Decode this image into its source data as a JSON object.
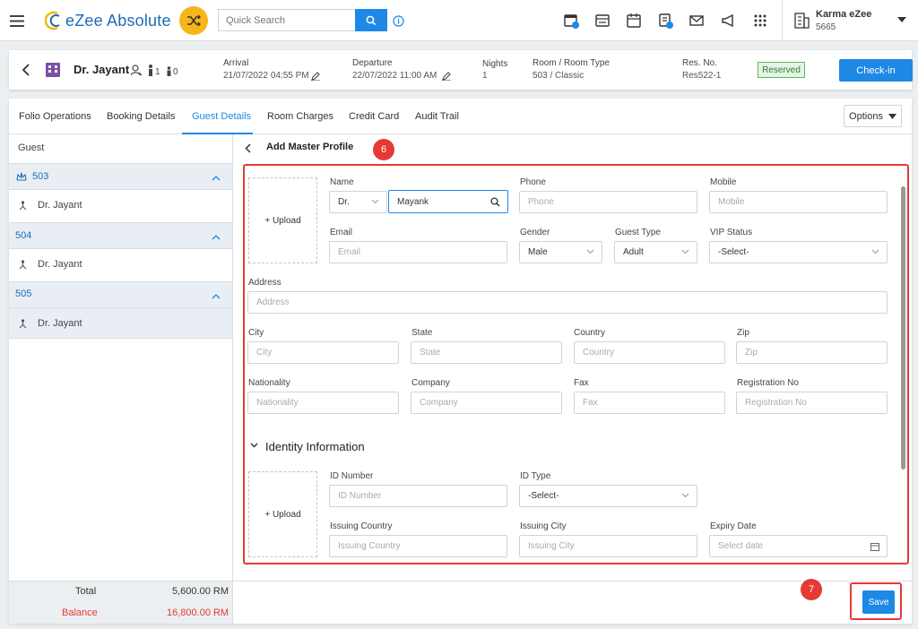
{
  "brand": {
    "name": "eZee Absolute"
  },
  "search": {
    "placeholder": "Quick Search"
  },
  "user": {
    "name": "Karma eZee",
    "id": "5665"
  },
  "reservation": {
    "guest_name": "Dr. Jayant",
    "adults": "1",
    "children": "0",
    "arrival_label": "Arrival",
    "arrival_value": "21/07/2022 04:55 PM",
    "departure_label": "Departure",
    "departure_value": "22/07/2022 11:00 AM",
    "nights_label": "Nights",
    "nights_value": "1",
    "room_label": "Room / Room Type",
    "room_value": "503 / Classic",
    "resno_label": "Res. No.",
    "resno_value": "Res522-1",
    "status": "Reserved",
    "checkin_label": "Check-in"
  },
  "tabs": [
    "Folio Operations",
    "Booking Details",
    "Guest Details",
    "Room Charges",
    "Credit Card",
    "Audit Trail"
  ],
  "options_label": "Options",
  "guest_panel": {
    "header": "Guest",
    "groups": [
      {
        "room": "503",
        "guest": "Dr. Jayant"
      },
      {
        "room": "504",
        "guest": "Dr. Jayant"
      },
      {
        "room": "505",
        "guest": "Dr. Jayant"
      }
    ],
    "total_label": "Total",
    "total_value": "5,600.00 RM",
    "balance_label": "Balance",
    "balance_value": "16,800.00 RM"
  },
  "form": {
    "title": "Add Master Profile",
    "step_badge": "6",
    "upload_label": "+ Upload",
    "name_label": "Name",
    "salutation": "Dr.",
    "name_value": "Mayank",
    "phone_label": "Phone",
    "phone_placeholder": "Phone",
    "mobile_label": "Mobile",
    "mobile_placeholder": "Mobile",
    "email_label": "Email",
    "email_placeholder": "Email",
    "gender_label": "Gender",
    "gender_value": "Male",
    "guest_type_label": "Guest Type",
    "guest_type_value": "Adult",
    "vip_label": "VIP Status",
    "vip_value": "-Select-",
    "address_label": "Address",
    "address_placeholder": "Address",
    "city_label": "City",
    "city_placeholder": "City",
    "state_label": "State",
    "state_placeholder": "State",
    "country_label": "Country",
    "country_placeholder": "Country",
    "zip_label": "Zip",
    "zip_placeholder": "Zip",
    "nationality_label": "Nationality",
    "nationality_placeholder": "Nationality",
    "company_label": "Company",
    "company_placeholder": "Company",
    "fax_label": "Fax",
    "fax_placeholder": "Fax",
    "regno_label": "Registration No",
    "regno_placeholder": "Registration No",
    "identity_title": "Identity Information",
    "idnum_label": "ID Number",
    "idnum_placeholder": "ID Number",
    "idtype_label": "ID Type",
    "idtype_value": "-Select-",
    "issuing_country_label": "Issuing Country",
    "issuing_country_placeholder": "Issuing Country",
    "issuing_city_label": "Issuing City",
    "issuing_city_placeholder": "Issuing City",
    "expiry_label": "Expiry Date",
    "expiry_placeholder": "Select date"
  },
  "save": {
    "label": "Save",
    "step_badge": "7"
  },
  "colors": {
    "accent": "#1e88e5",
    "highlight": "#e53935",
    "brand_yellow": "#f6b619",
    "status_green": "#5cb85c"
  }
}
